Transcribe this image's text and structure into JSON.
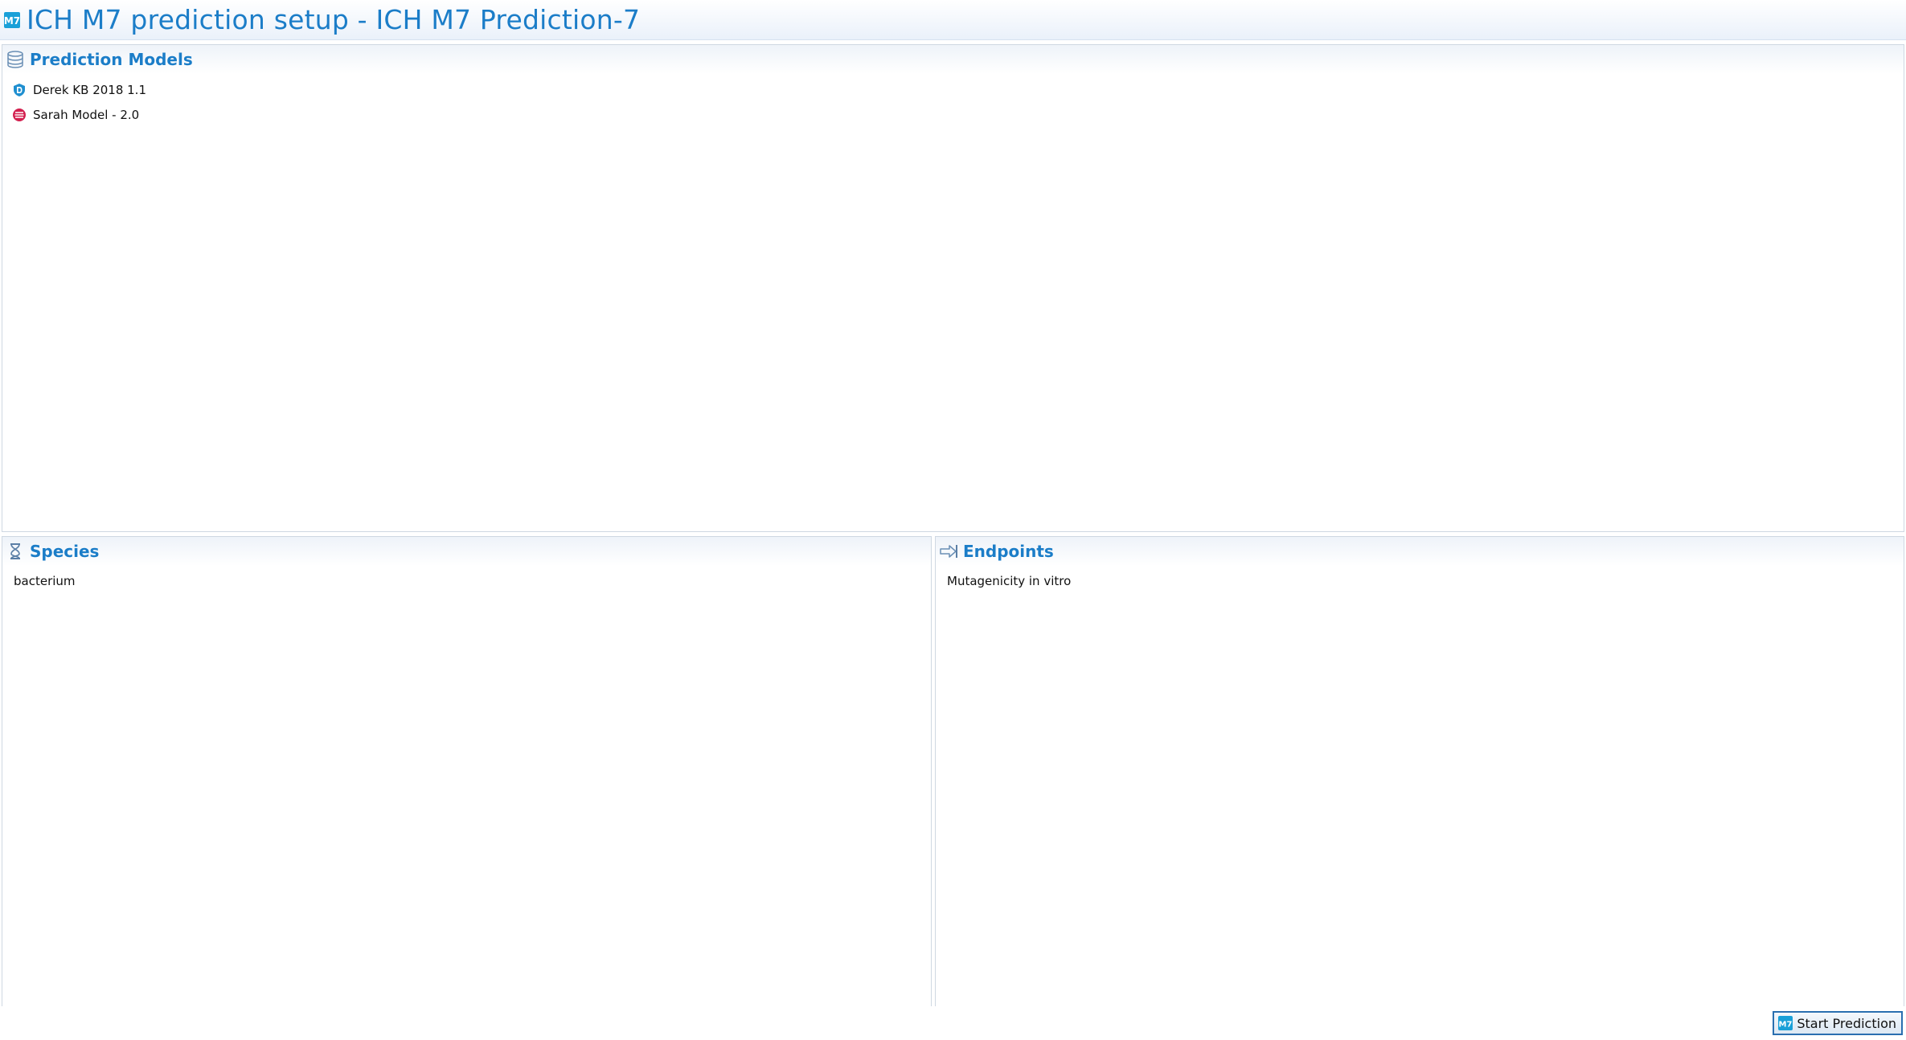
{
  "window": {
    "title": "ICH M7 prediction setup - ICH M7 Prediction-7",
    "app_icon": "m7-logo-icon"
  },
  "prediction_models": {
    "title": "Prediction Models",
    "icon": "database-icon",
    "items": [
      {
        "label": "Derek KB 2018 1.1",
        "icon": "derek-shield-icon",
        "color": "#1f8fd0"
      },
      {
        "label": "Sarah Model - 2.0",
        "icon": "sarah-logo-icon",
        "color": "#d3204f"
      }
    ]
  },
  "species": {
    "title": "Species",
    "icon": "hourglass-icon",
    "items": [
      {
        "label": "bacterium"
      }
    ]
  },
  "endpoints": {
    "title": "Endpoints",
    "icon": "arrow-right-icon",
    "items": [
      {
        "label": "Mutagenicity in vitro"
      }
    ]
  },
  "actions": {
    "start_prediction_label": "Start Prediction",
    "start_prediction_icon": "m7-logo-icon"
  },
  "colors": {
    "accent": "#1b7dc8",
    "panel_border": "#cfd8e2",
    "button_border": "#2a6fb0"
  }
}
